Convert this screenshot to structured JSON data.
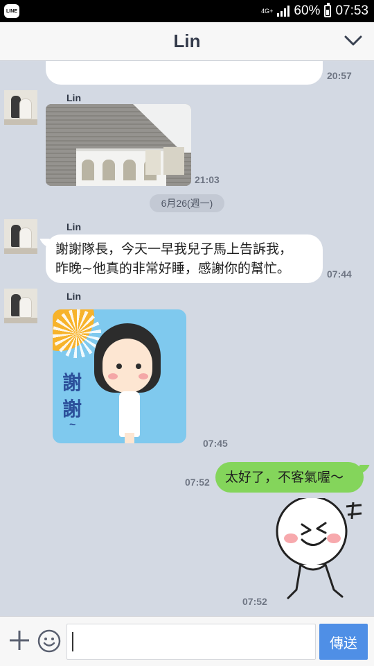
{
  "status_bar": {
    "app_badge": "LINE",
    "network": "4G+",
    "battery": "60%",
    "time": "07:53"
  },
  "header": {
    "title": "Lin",
    "collapse_icon": "chevron-down-icon"
  },
  "messages": [
    {
      "type": "text-partial",
      "side": "left",
      "time": "20:57"
    },
    {
      "type": "image",
      "side": "left",
      "sender": "Lin",
      "time": "21:03"
    },
    {
      "type": "date",
      "label": "6月26(週一)"
    },
    {
      "type": "text",
      "side": "left",
      "sender": "Lin",
      "lines": [
        "謝謝隊長，今天一早我兒子馬上告訴我，",
        "昨晚~他真的非常好睡，感謝你的幫忙。"
      ],
      "time": "07:44"
    },
    {
      "type": "sticker",
      "side": "left",
      "sender": "Lin",
      "sticker_text": [
        "謝",
        "謝",
        "~"
      ],
      "time": "07:45"
    },
    {
      "type": "text",
      "side": "right",
      "text": "太好了，不客氣喔～",
      "time": "07:52"
    },
    {
      "type": "sticker",
      "side": "right",
      "time": "07:52"
    }
  ],
  "input_bar": {
    "plus_icon": "plus-icon",
    "emoji_icon": "emoji-icon",
    "value": "",
    "send_label": "傳送"
  },
  "colors": {
    "chat_bg": "#d3d9e3",
    "my_bubble": "#84d55b",
    "send_button": "#4f8fe6"
  }
}
